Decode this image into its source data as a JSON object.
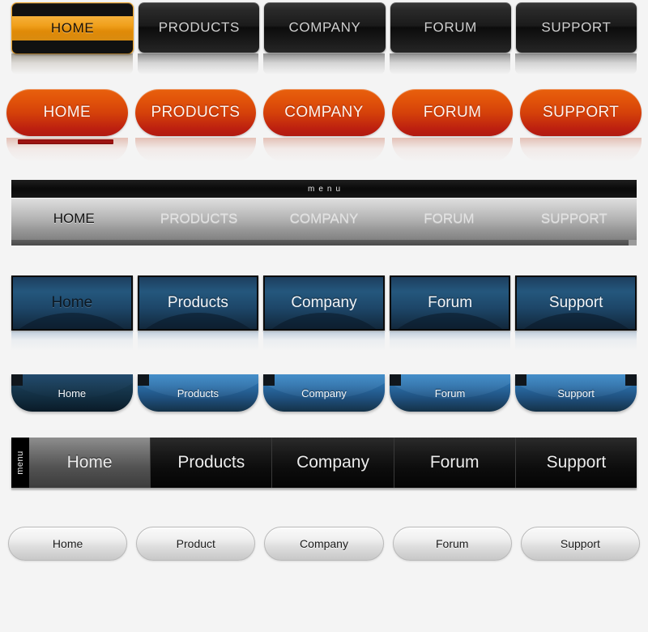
{
  "page": {
    "title": "Web Navigation Button Set",
    "background_color": "#f4f4f4"
  },
  "labels": {
    "menu": "menu"
  },
  "colors": {
    "orange_accent": "#f0a01c",
    "red_accent": "#d4400a",
    "navy_accent": "#24577d",
    "blue_accent": "#2f7fc0",
    "underline_red": "#a41513"
  },
  "navsets": [
    {
      "id": "dark-rounded",
      "style": "black-rounded-buttons-with-orange-active",
      "items": [
        {
          "label": "HOME",
          "active": true
        },
        {
          "label": "PRODUCTS",
          "active": false
        },
        {
          "label": "COMPANY",
          "active": false
        },
        {
          "label": "FORUM",
          "active": false
        },
        {
          "label": "SUPPORT",
          "active": false
        }
      ]
    },
    {
      "id": "orange-pills",
      "style": "orange-gradient-pill-buttons",
      "items": [
        {
          "label": "HOME",
          "active": true
        },
        {
          "label": "PRODUCTS",
          "active": false
        },
        {
          "label": "COMPANY",
          "active": false
        },
        {
          "label": "FORUM",
          "active": false
        },
        {
          "label": "SUPPORT",
          "active": false
        }
      ]
    },
    {
      "id": "silver-bar",
      "style": "silver-gradient-menu-bar",
      "header_label": "menu",
      "items": [
        {
          "label": "HOME",
          "active": true
        },
        {
          "label": "PRODUCTS",
          "active": false
        },
        {
          "label": "COMPANY",
          "active": false
        },
        {
          "label": "FORUM",
          "active": false
        },
        {
          "label": "SUPPORT",
          "active": false
        }
      ]
    },
    {
      "id": "navy-blocks",
      "style": "navy-blue-block-buttons",
      "items": [
        {
          "label": "Home",
          "active": true
        },
        {
          "label": "Products",
          "active": false
        },
        {
          "label": "Company",
          "active": false
        },
        {
          "label": "Forum",
          "active": false
        },
        {
          "label": "Support",
          "active": false
        }
      ]
    },
    {
      "id": "blue-tabs",
      "style": "blue-rounded-bottom-tabs",
      "items": [
        {
          "label": "Home",
          "active": true
        },
        {
          "label": "Products",
          "active": false
        },
        {
          "label": "Company",
          "active": false
        },
        {
          "label": "Forum",
          "active": false
        },
        {
          "label": "Support",
          "active": false
        }
      ]
    },
    {
      "id": "grey-bar",
      "style": "dark-grey-bar-with-vertical-menu-tab",
      "menu_tab_label": "menu",
      "items": [
        {
          "label": "Home",
          "active": true
        },
        {
          "label": "Products",
          "active": false
        },
        {
          "label": "Company",
          "active": false
        },
        {
          "label": "Forum",
          "active": false
        },
        {
          "label": "Support",
          "active": false
        }
      ]
    },
    {
      "id": "light-pills",
      "style": "light-silver-pill-buttons",
      "items": [
        {
          "label": "Home",
          "active": false
        },
        {
          "label": "Product",
          "active": false
        },
        {
          "label": "Company",
          "active": false
        },
        {
          "label": "Forum",
          "active": false
        },
        {
          "label": "Support",
          "active": false
        }
      ]
    }
  ]
}
